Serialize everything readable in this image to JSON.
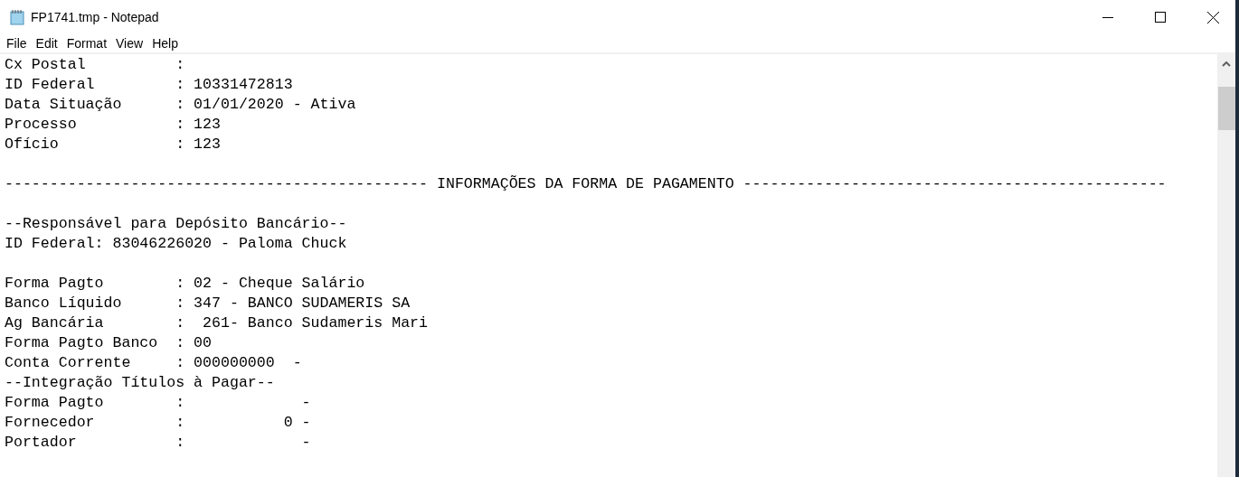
{
  "window": {
    "title": "FP1741.tmp - Notepad"
  },
  "menu": [
    "File",
    "Edit",
    "Format",
    "View",
    "Help"
  ],
  "document": {
    "blocks": [
      [
        "Cx Postal          :",
        "ID Federal         : 10331472813",
        "Data Situação      : 01/01/2020 - Ativa",
        "Processo           : 123",
        "Ofício             : 123"
      ],
      [
        "----------------------------------------------- INFORMAÇÕES DA FORMA DE PAGAMENTO -----------------------------------------------"
      ],
      [
        "--Responsável para Depósito Bancário--",
        "ID Federal: 83046226020 - Paloma Chuck"
      ],
      [
        "Forma Pagto        : 02 - Cheque Salário",
        "Banco Líquido      : 347 - BANCO SUDAMERIS SA",
        "Ag Bancária        :  261- Banco Sudameris Mari",
        "Forma Pagto Banco  : 00",
        "Conta Corrente     : 000000000  -",
        "--Integração Títulos à Pagar--",
        "Forma Pagto        :             -",
        "Fornecedor         :           0 -",
        "Portador           :             -"
      ]
    ]
  }
}
